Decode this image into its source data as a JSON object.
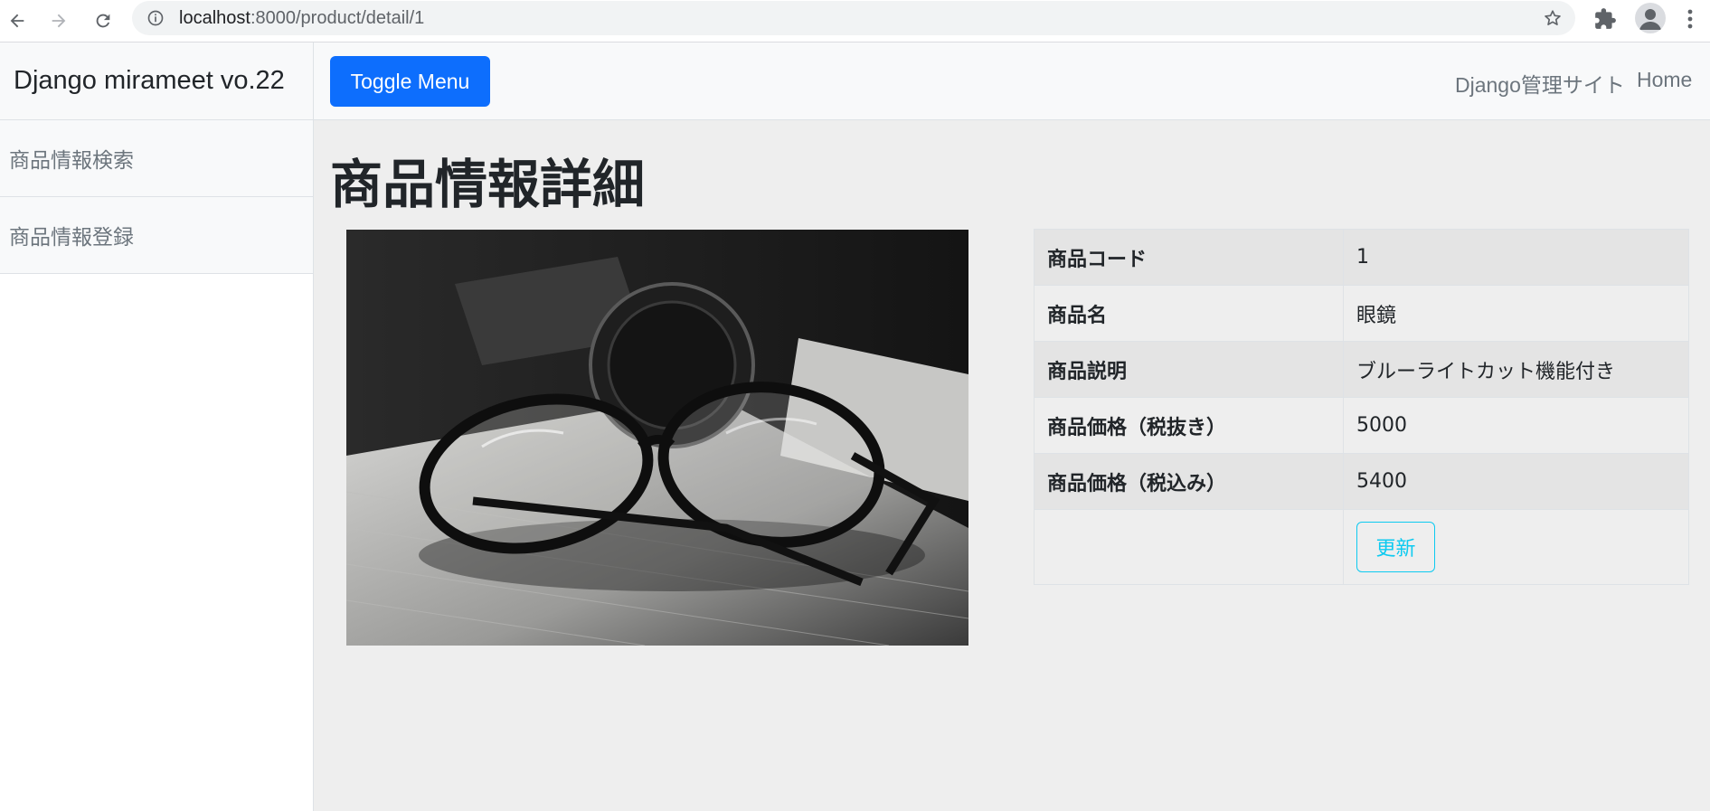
{
  "browser": {
    "url_host": "localhost",
    "url_path": ":8000/product/detail/1"
  },
  "sidebar": {
    "brand": "Django mirameet vo.22",
    "items": [
      {
        "label": "商品情報検索"
      },
      {
        "label": "商品情報登録"
      }
    ]
  },
  "topnav": {
    "toggle_label": "Toggle Menu",
    "links": [
      {
        "label": "Django管理サイト"
      },
      {
        "label": "Home"
      }
    ]
  },
  "main": {
    "title": "商品情報詳細",
    "image": {
      "subject": "eyeglasses on a desk",
      "style": "black-and-white photo"
    },
    "details": [
      {
        "label": "商品コード",
        "value": "1"
      },
      {
        "label": "商品名",
        "value": "眼鏡"
      },
      {
        "label": "商品説明",
        "value": "ブルーライトカット機能付き"
      },
      {
        "label": "商品価格（税抜き）",
        "value": "5000"
      },
      {
        "label": "商品価格（税込み）",
        "value": "5400"
      }
    ],
    "update_label": "更新"
  },
  "colors": {
    "primary": "#0d6efd",
    "info": "#0dcaf0",
    "sidebar_bg": "#f8f9fa",
    "main_bg": "#eeeeee"
  }
}
